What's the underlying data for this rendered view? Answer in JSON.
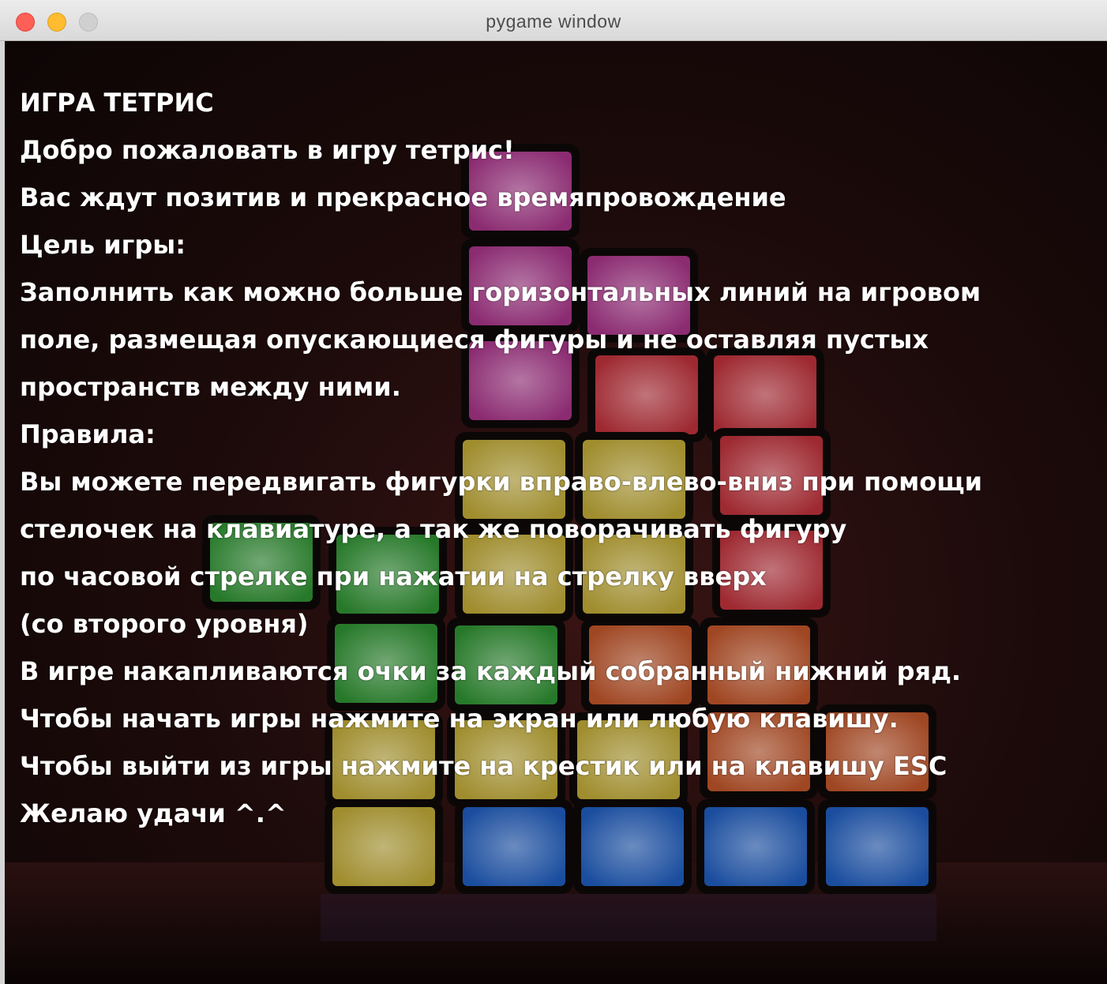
{
  "window": {
    "title": "pygame window"
  },
  "intro": {
    "lines": [
      "ИГРА ТЕТРИС",
      "Добро пожаловать в игру тетрис!",
      "Вас ждут позитив и прекрасное времяпровождение",
      "Цель игры:",
      "Заполнить как можно больше горизонтальных линий на игровом",
      "поле, размещая опускающиеся фигуры и не оставляя пустых",
      "пространств между ними.",
      "Правила:",
      "Вы можете передвигать фигурки вправо-влево-вниз при помощи",
      "стелочек на клавиатуре, а так же поворачивать фигуру",
      "по часовой стрелке при нажатии на стрелку вверх",
      "(со второго уровня)",
      "В игре накапливаются очки за каждый собранный нижний ряд.",
      "Чтобы начать игры нажмите на экран или любую клавишу.",
      "Чтобы выйти из игры нажмите на крестик или на клавишу ESC",
      "Желаю удачи ^.^"
    ]
  },
  "background": {
    "description_colors": {
      "magenta": "#b0368f",
      "red": "#c8333e",
      "yellow": "#c9b43a",
      "green": "#2f9a35",
      "orange": "#c9582a",
      "blue": "#1f62c9"
    }
  }
}
